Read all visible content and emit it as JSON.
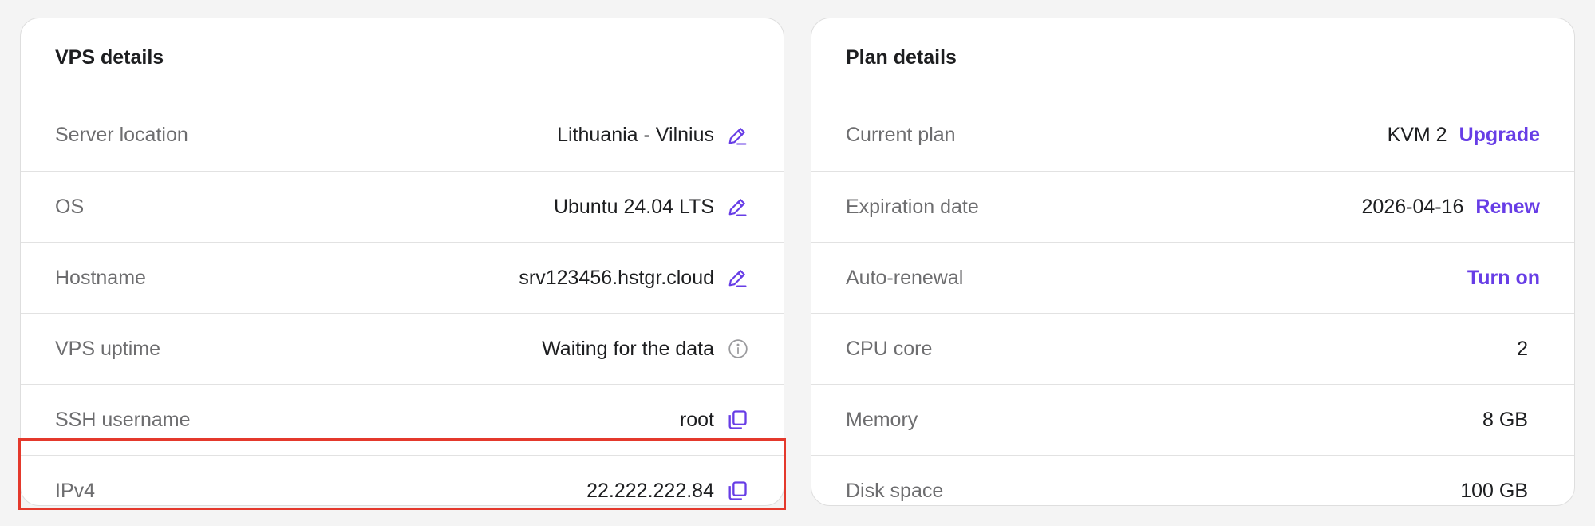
{
  "accent_color": "#673de6",
  "highlight_color": "#e4392c",
  "vps_details": {
    "title": "VPS details",
    "rows": [
      {
        "label": "Server location",
        "value": "Lithuania - Vilnius",
        "icon": "pencil-icon"
      },
      {
        "label": "OS",
        "value": "Ubuntu 24.04 LTS",
        "icon": "pencil-icon"
      },
      {
        "label": "Hostname",
        "value": "srv123456.hstgr.cloud",
        "icon": "pencil-icon"
      },
      {
        "label": "VPS uptime",
        "value": "Waiting for the data",
        "icon": "info-icon"
      },
      {
        "label": "SSH username",
        "value": "root",
        "icon": "copy-icon"
      },
      {
        "label": "IPv4",
        "value": "22.222.222.84",
        "icon": "copy-icon",
        "highlighted": true
      }
    ]
  },
  "plan_details": {
    "title": "Plan details",
    "rows": [
      {
        "label": "Current plan",
        "value": "KVM 2",
        "action": "Upgrade"
      },
      {
        "label": "Expiration date",
        "value": "2026-04-16",
        "action": "Renew"
      },
      {
        "label": "Auto-renewal",
        "action": "Turn on"
      },
      {
        "label": "CPU core",
        "value": "2"
      },
      {
        "label": "Memory",
        "value": "8 GB"
      },
      {
        "label": "Disk space",
        "value": "100 GB"
      }
    ]
  }
}
